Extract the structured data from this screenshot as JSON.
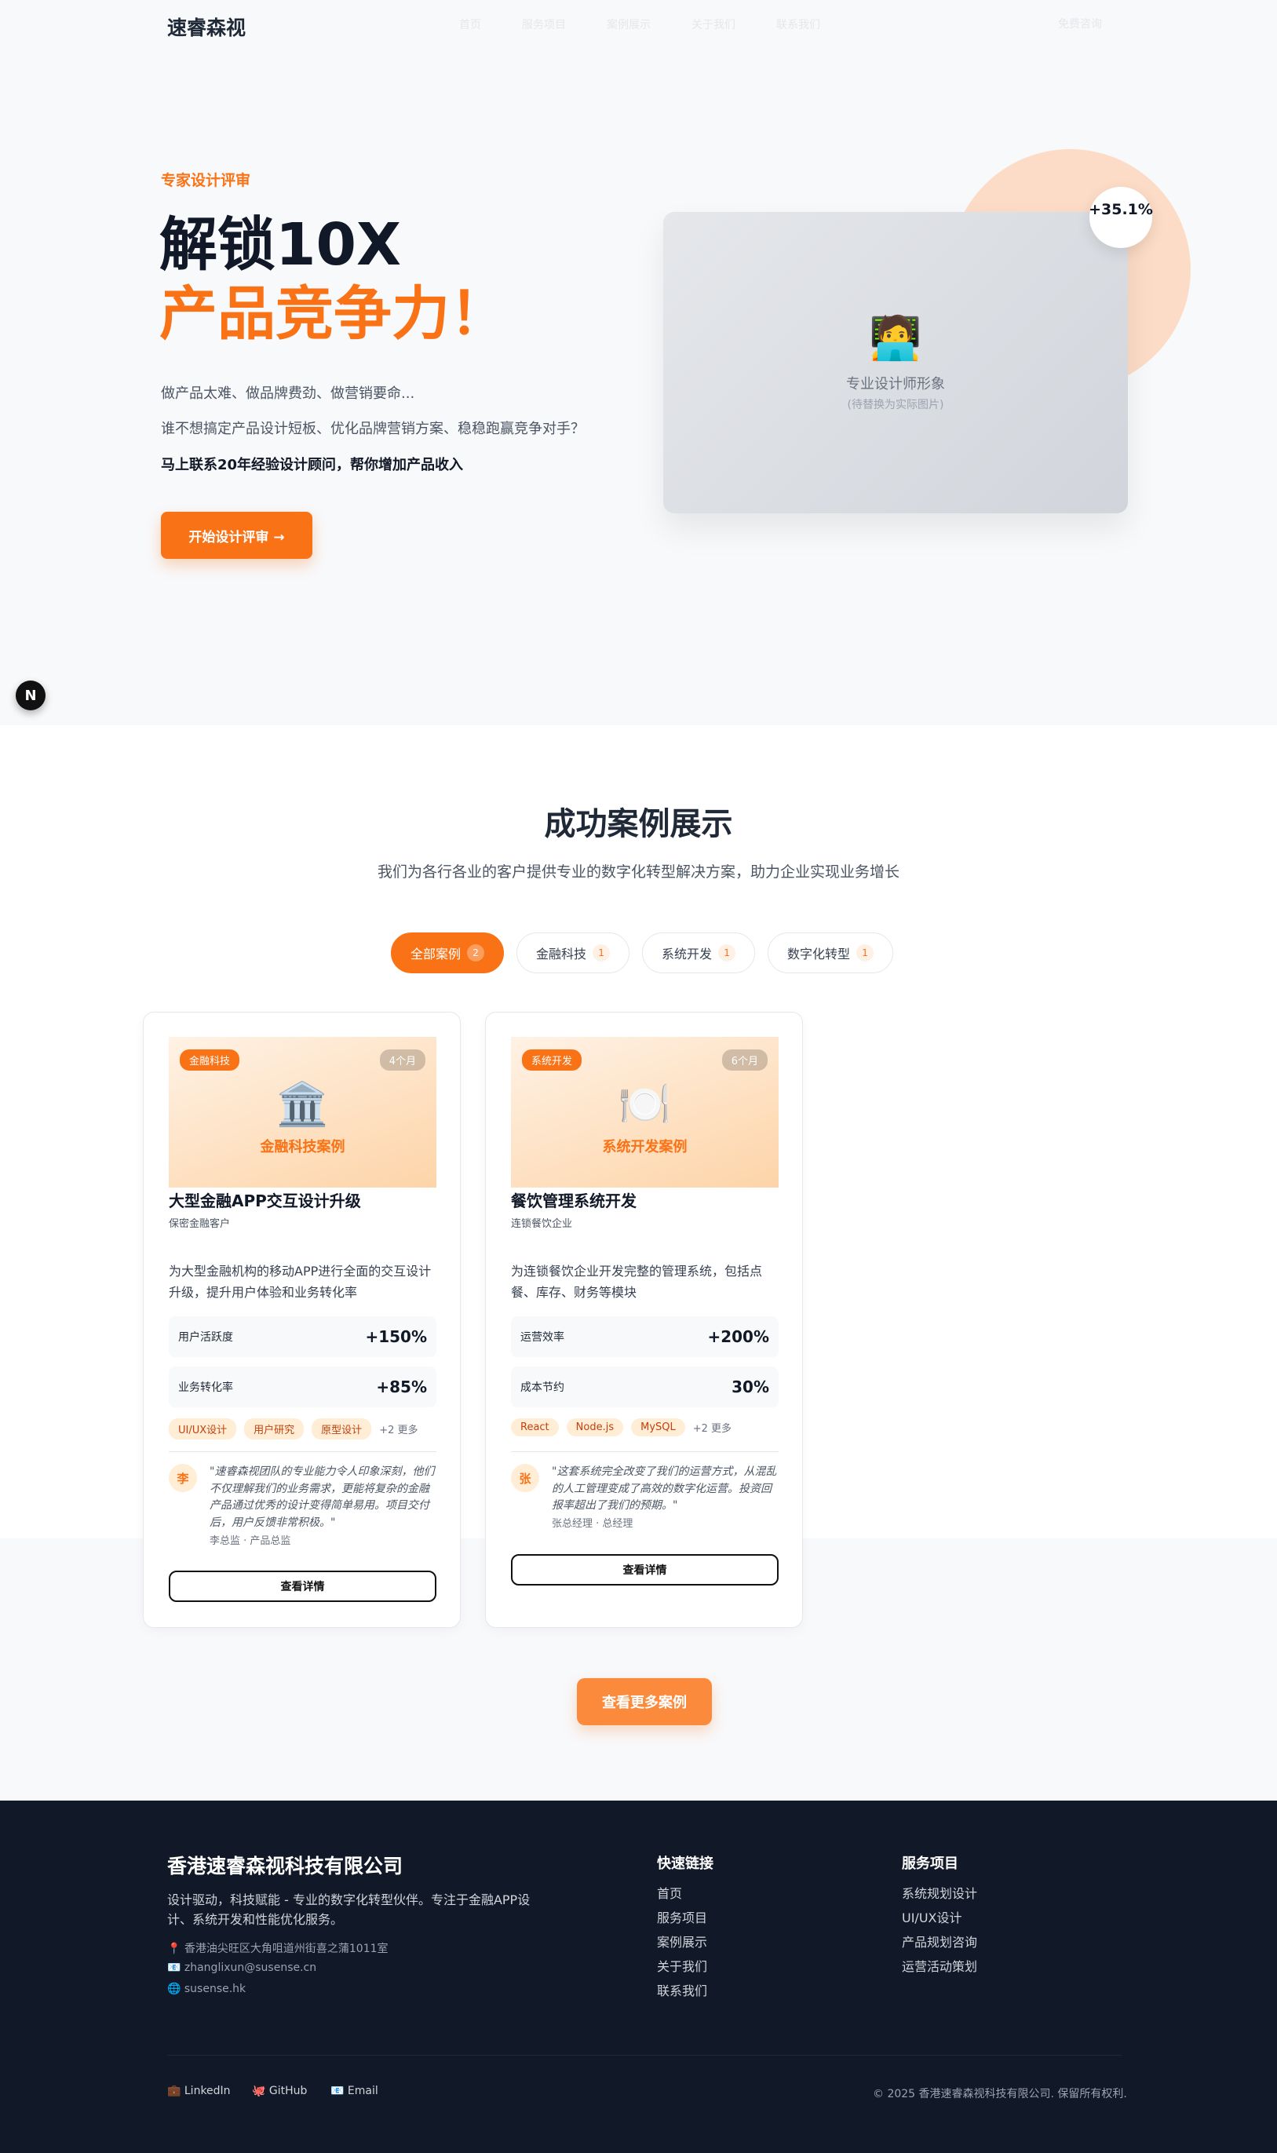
{
  "nav": {
    "logo": "速睿森视",
    "links": [
      "首页",
      "服务项目",
      "案例展示",
      "关于我们",
      "联系我们"
    ],
    "cta": "免费咨询"
  },
  "hero": {
    "eyebrow": "专家设计评审",
    "title_line1": "解锁10X",
    "title_line2": "产品竞争力！",
    "para1": "做产品太难、做品牌费劲、做营销要命...",
    "para2": "谁不想搞定产品设计短板、优化品牌营销方案、稳稳跑赢竞争对手？",
    "para3": "马上联系20年经验设计顾问，帮你增加产品收入",
    "button": "开始设计评审 →",
    "stat": "+35.1%",
    "photo_emoji": "🧑‍💻",
    "photo_label": "专业设计师形象",
    "photo_sub": "(待替换为实际图片)",
    "badge": "N"
  },
  "cases": {
    "title": "成功案例展示",
    "subtitle": "我们为各行各业的客户提供专业的数字化转型解决方案，助力企业实现业务增长",
    "tabs": [
      {
        "label": "全部案例",
        "count": "2"
      },
      {
        "label": "金融科技",
        "count": "1"
      },
      {
        "label": "系统开发",
        "count": "1"
      },
      {
        "label": "数字化转型",
        "count": "1"
      }
    ],
    "cards": [
      {
        "tag": "金融科技",
        "duration": "4个月",
        "icon": "🏛️",
        "image_label": "金融科技案例",
        "title": "大型金融APP交互设计升级",
        "client": "保密金融客户",
        "desc": "为大型金融机构的移动APP进行全面的交互设计升级，提升用户体验和业务转化率",
        "metrics": [
          {
            "label": "用户活跃度",
            "value": "+150%"
          },
          {
            "label": "业务转化率",
            "value": "+85%"
          }
        ],
        "tags": [
          "UI/UX设计",
          "用户研究",
          "原型设计"
        ],
        "more": "+2 更多",
        "avatar": "李",
        "quote": "\"速睿森视团队的专业能力令人印象深刻，他们不仅理解我们的业务需求，更能将复杂的金融产品通过优秀的设计变得简单易用。项目交付后，用户反馈非常积极。\"",
        "author": "李总监 · 产品总监",
        "button": "查看详情"
      },
      {
        "tag": "系统开发",
        "duration": "6个月",
        "icon": "🍽️",
        "image_label": "系统开发案例",
        "title": "餐饮管理系统开发",
        "client": "连锁餐饮企业",
        "desc": "为连锁餐饮企业开发完整的管理系统，包括点餐、库存、财务等模块",
        "metrics": [
          {
            "label": "运营效率",
            "value": "+200%"
          },
          {
            "label": "成本节约",
            "value": "30%"
          }
        ],
        "tags": [
          "React",
          "Node.js",
          "MySQL"
        ],
        "more": "+2 更多",
        "avatar": "张",
        "quote": "\"这套系统完全改变了我们的运营方式，从混乱的人工管理变成了高效的数字化运营。投资回报率超出了我们的预期。\"",
        "author": "张总经理 · 总经理",
        "button": "查看详情"
      }
    ],
    "more_button": "查看更多案例"
  },
  "footer": {
    "company": "香港速睿森视科技有限公司",
    "desc": "设计驱动，科技赋能 - 专业的数字化转型伙伴。专注于金融APP设计、系统开发和性能优化服务。",
    "address": "📍 香港油尖旺区大角咀道州街喜之蒲1011室",
    "email": "📧 zhanglixun@susense.cn",
    "site": "🌐 susense.hk",
    "quick_title": "快速链接",
    "quick_links": [
      "首页",
      "服务项目",
      "案例展示",
      "关于我们",
      "联系我们"
    ],
    "services_title": "服务项目",
    "services": [
      "系统规划设计",
      "UI/UX设计",
      "产品规划咨询",
      "运营活动策划"
    ],
    "social": [
      "💼 LinkedIn",
      "🐙 GitHub",
      "📧 Email"
    ],
    "copyright": "© 2025 香港速睿森视科技有限公司. 保留所有权利."
  }
}
